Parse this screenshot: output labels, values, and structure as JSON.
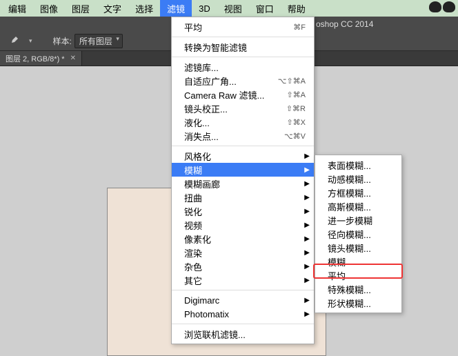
{
  "menubar": {
    "items": [
      "编辑",
      "图像",
      "图层",
      "文字",
      "选择",
      "滤镜",
      "3D",
      "视图",
      "窗口",
      "帮助"
    ],
    "active_index": 5
  },
  "app_title": "oshop CC 2014",
  "options_bar": {
    "sample_label": "样本:",
    "sample_value": "所有图层"
  },
  "doc_tab": {
    "title": "图层 2, RGB/8*) *"
  },
  "filter_menu": {
    "recent": {
      "label": "平均",
      "shortcut": "⌘F"
    },
    "convert_smart": "转换为智能滤镜",
    "group1": [
      {
        "label": "滤镜库...",
        "shortcut": ""
      },
      {
        "label": "自适应广角...",
        "shortcut": "⌥⇧⌘A"
      },
      {
        "label": "Camera Raw 滤镜...",
        "shortcut": "⇧⌘A"
      },
      {
        "label": "镜头校正...",
        "shortcut": "⇧⌘R"
      },
      {
        "label": "液化...",
        "shortcut": "⇧⌘X"
      },
      {
        "label": "消失点...",
        "shortcut": "⌥⌘V"
      }
    ],
    "group2": [
      {
        "label": "风格化",
        "sub": true
      },
      {
        "label": "模糊",
        "sub": true,
        "highlight": true
      },
      {
        "label": "模糊画廊",
        "sub": true
      },
      {
        "label": "扭曲",
        "sub": true
      },
      {
        "label": "锐化",
        "sub": true
      },
      {
        "label": "视频",
        "sub": true
      },
      {
        "label": "像素化",
        "sub": true
      },
      {
        "label": "渲染",
        "sub": true
      },
      {
        "label": "杂色",
        "sub": true
      },
      {
        "label": "其它",
        "sub": true
      }
    ],
    "group3": [
      {
        "label": "Digimarc",
        "sub": true
      },
      {
        "label": "Photomatix",
        "sub": true
      }
    ],
    "browse": "浏览联机滤镜..."
  },
  "blur_submenu": {
    "items": [
      "表面模糊...",
      "动感模糊...",
      "方框模糊...",
      "高斯模糊...",
      "进一步模糊",
      "径向模糊...",
      "镜头模糊...",
      "模糊",
      "平均",
      "特殊模糊...",
      "形状模糊..."
    ]
  }
}
